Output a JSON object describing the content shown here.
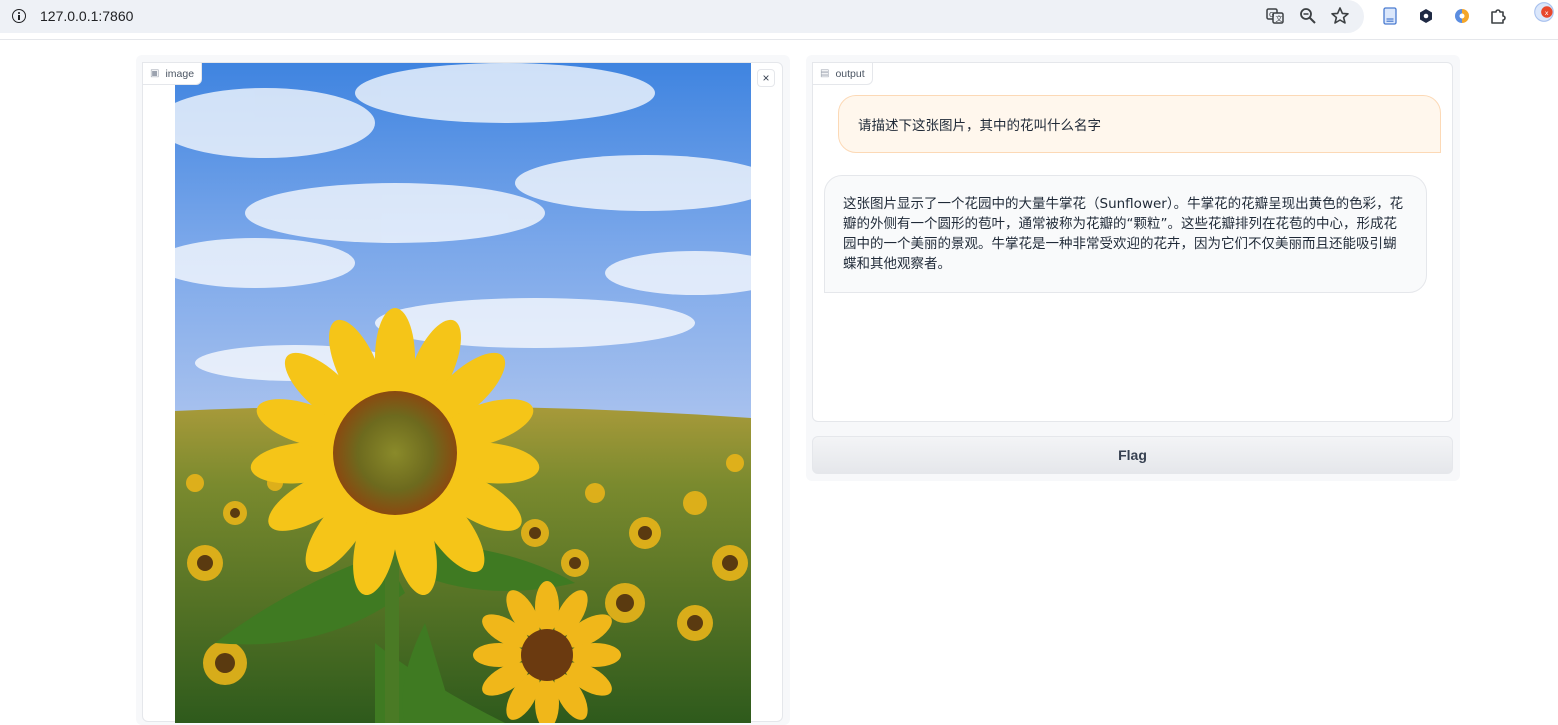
{
  "browser": {
    "url": "127.0.0.1:7860",
    "icons": [
      "info-icon",
      "translate-icon",
      "zoom-icon",
      "star-icon",
      "document-extension-icon",
      "hex-extension-icon",
      "color-extension-icon",
      "extensions-puzzle-icon",
      "profile-avatar-icon"
    ]
  },
  "image_panel": {
    "label": "image",
    "label_icon": "image-icon",
    "clear_symbol": "×"
  },
  "output_panel": {
    "label": "output",
    "label_icon": "chat-icon",
    "messages": [
      {
        "role": "user",
        "text": "请描述下这张图片，其中的花叫什么名字"
      },
      {
        "role": "bot",
        "text": "这张图片显示了一个花园中的大量牛掌花（Sunflower）。牛掌花的花瓣呈现出黄色的色彩，花瓣的外侧有一个圆形的苞叶，通常被称为花瓣的“颗粒”。这些花瓣排列在花苞的中心，形成花园中的一个美丽的景观。牛掌花是一种非常受欢迎的花卉，因为它们不仅美丽而且还能吸引蝴蝶和其他观察者。"
      }
    ]
  },
  "flag_button": {
    "label": "Flag"
  },
  "colors": {
    "user_bubble": "#fff7ed",
    "user_border": "#fcd9b6",
    "bot_bubble": "#f9fafb",
    "sky": "#5b8de0",
    "sunflower": "#f5c518"
  }
}
